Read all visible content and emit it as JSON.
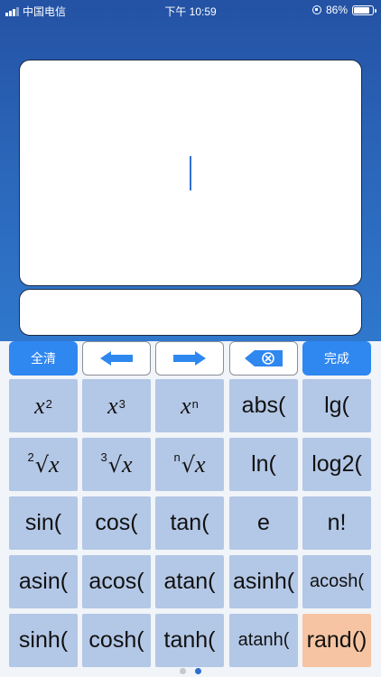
{
  "status_bar": {
    "carrier": "中国电信",
    "time": "下午 10:59",
    "battery": "86%",
    "battery_level": 0.86
  },
  "controls": {
    "clear_label": "全清",
    "done_label": "完成",
    "left_icon": "arrow-left-icon",
    "right_icon": "arrow-right-icon",
    "backspace_icon": "backspace-icon",
    "accent_color": "#2f87f0"
  },
  "keys": {
    "x_squared": {
      "base": "x",
      "sup": "2"
    },
    "x_cubed": {
      "base": "x",
      "sup": "3"
    },
    "x_pow_n": {
      "base": "x",
      "sup": "n"
    },
    "abs": "abs(",
    "lg": "lg(",
    "sqrt2": {
      "pre": "2",
      "rad": "√",
      "base": "x"
    },
    "sqrt3": {
      "pre": "3",
      "rad": "√",
      "base": "x"
    },
    "sqrtn": {
      "pre": "n",
      "rad": "√",
      "base": "x"
    },
    "ln": "ln(",
    "log2": "log2(",
    "sin": "sin(",
    "cos": "cos(",
    "tan": "tan(",
    "e": "e",
    "factorial": "n!",
    "asin": "asin(",
    "acos": "acos(",
    "atan": "atan(",
    "asinh": "asinh(",
    "acosh": "acosh(",
    "sinh": "sinh(",
    "cosh": "cosh(",
    "tanh": "tanh(",
    "atanh": "atanh(",
    "rand": "rand()"
  },
  "page_indicator": {
    "pages": 2,
    "current": 2
  }
}
